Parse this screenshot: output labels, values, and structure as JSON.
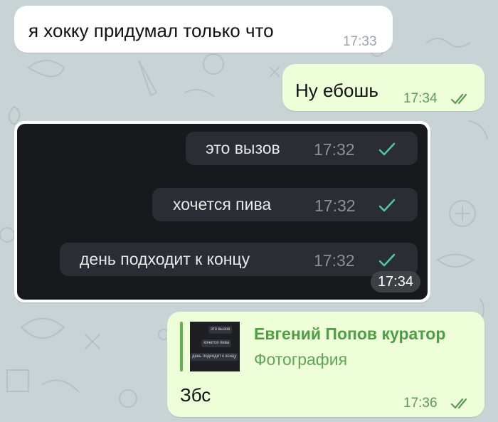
{
  "messages": {
    "m1": {
      "text": "я хокку придумал только что",
      "time": "17:33"
    },
    "m2": {
      "text": "Ну ебошь",
      "time": "17:34"
    },
    "photo": {
      "time": "17:34",
      "lines": [
        {
          "text": "это вызов",
          "time": "17:32"
        },
        {
          "text": "хочется пива",
          "time": "17:32"
        },
        {
          "text": "день подходит к концу",
          "time": "17:32"
        }
      ]
    },
    "m4": {
      "reply_author": "Евгений Попов куратор",
      "reply_type": "Фотография",
      "text": "Збс",
      "time": "17:36"
    }
  },
  "icons": {
    "sent": "single-check-icon",
    "read": "double-check-icon"
  },
  "colors": {
    "wallpaper": "#c8d3d6",
    "incoming": "#ffffff",
    "outgoing": "#eefed9",
    "accent_green": "#4f9d44",
    "photo_check": "#4ec6a4"
  }
}
